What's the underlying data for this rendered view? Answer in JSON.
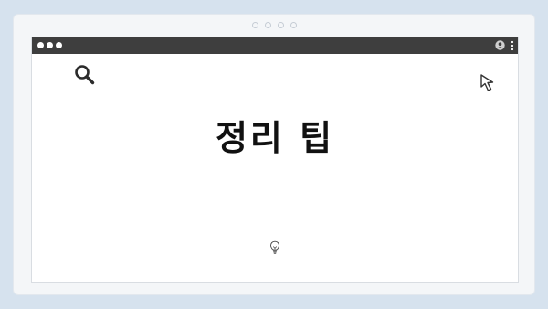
{
  "page": {
    "headline": "정리 팁"
  },
  "icons": {
    "search": "search-icon",
    "cursor": "cursor-icon",
    "bulb": "lightbulb-icon",
    "user": "user-icon",
    "menu": "kebab-menu-icon"
  },
  "colors": {
    "background": "#d6e2ee",
    "window": "#f4f6f8",
    "titlebar": "#3e3e3e",
    "content": "#ffffff",
    "headline": "#111111"
  }
}
